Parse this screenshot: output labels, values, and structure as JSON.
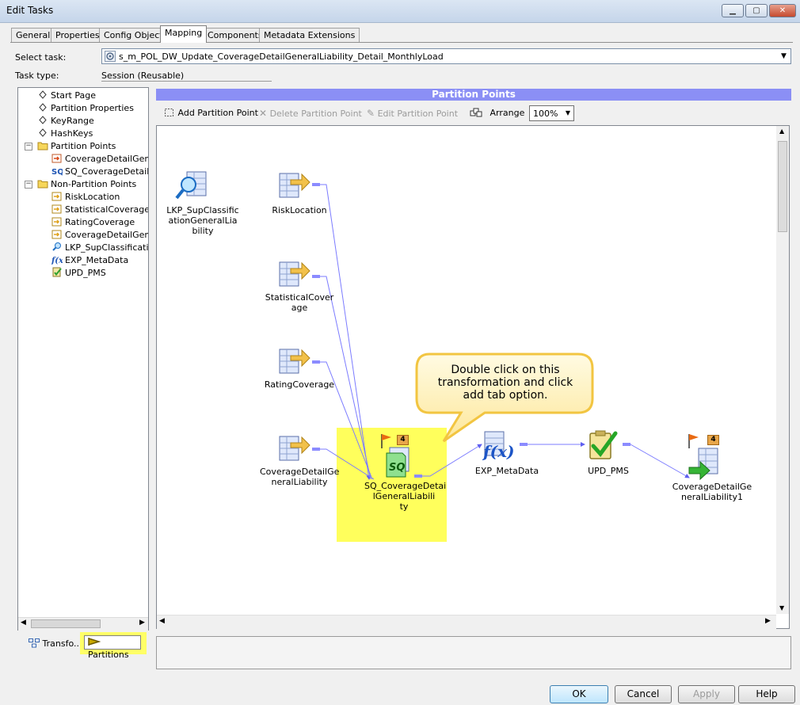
{
  "window": {
    "title": "Edit Tasks"
  },
  "tabs": [
    {
      "label": "General"
    },
    {
      "label": "Properties"
    },
    {
      "label": "Config Object"
    },
    {
      "label": "Mapping",
      "active": true
    },
    {
      "label": "Components"
    },
    {
      "label": "Metadata Extensions"
    }
  ],
  "task": {
    "select_label": "Select task:",
    "selected_value": "s_m_POL_DW_Update_CoverageDetailGeneralLiability_Detail_MonthlyLoad",
    "type_label": "Task type:",
    "type_value": "Session (Reusable)"
  },
  "tree": {
    "items": [
      {
        "label": "Start Page",
        "icon": "diamond-icon"
      },
      {
        "label": "Partition Properties",
        "icon": "diamond-icon"
      },
      {
        "label": "KeyRange",
        "icon": "diamond-icon"
      },
      {
        "label": "HashKeys",
        "icon": "diamond-icon"
      },
      {
        "label": "Partition Points",
        "icon": "folder-icon"
      },
      {
        "label": "CoverageDetailGener",
        "icon": "target-icon"
      },
      {
        "label": "SQ_CoverageDetailGe",
        "icon": "sq-icon"
      },
      {
        "label": "Non-Partition Points",
        "icon": "folder-icon"
      },
      {
        "label": "RiskLocation",
        "icon": "source-icon"
      },
      {
        "label": "StatisticalCoverage",
        "icon": "source-icon"
      },
      {
        "label": "RatingCoverage",
        "icon": "source-icon"
      },
      {
        "label": "CoverageDetailGener",
        "icon": "source-icon"
      },
      {
        "label": "LKP_SupClassification",
        "icon": "lookup-icon"
      },
      {
        "label": "EXP_MetaData",
        "icon": "expression-icon"
      },
      {
        "label": "UPD_PMS",
        "icon": "update-icon"
      }
    ]
  },
  "bottom_tabs": {
    "transformations": "Transfo...",
    "partitions": "Partitions"
  },
  "panel": {
    "header": "Partition Points"
  },
  "toolbar": {
    "add": "Add Partition Point",
    "delete": "Delete Partition Point",
    "edit": "Edit Partition Point",
    "arrange": "Arrange",
    "zoom": "100%"
  },
  "canvas": {
    "nodes": {
      "lkp": [
        "LKP_SupClassific",
        "ationGeneralLia",
        "bility"
      ],
      "risk": [
        "RiskLocation"
      ],
      "stat": [
        "StatisticalCover",
        "age"
      ],
      "rating": [
        "RatingCoverage"
      ],
      "cov": [
        "CoverageDetailGe",
        "neralLiability"
      ],
      "sq": [
        "SQ_CoverageDetai",
        "lGeneralLiabili",
        "ty"
      ],
      "exp": [
        "EXP_MetaData"
      ],
      "upd": [
        "UPD_PMS"
      ],
      "target": [
        "CoverageDetailGe",
        "neralLiability1"
      ]
    },
    "sq_badge": "4",
    "target_badge": "4",
    "callout": [
      "Double click on this",
      "transformation and click",
      "add tab option."
    ]
  },
  "buttons": {
    "ok": "OK",
    "cancel": "Cancel",
    "apply": "Apply",
    "help": "Help"
  }
}
